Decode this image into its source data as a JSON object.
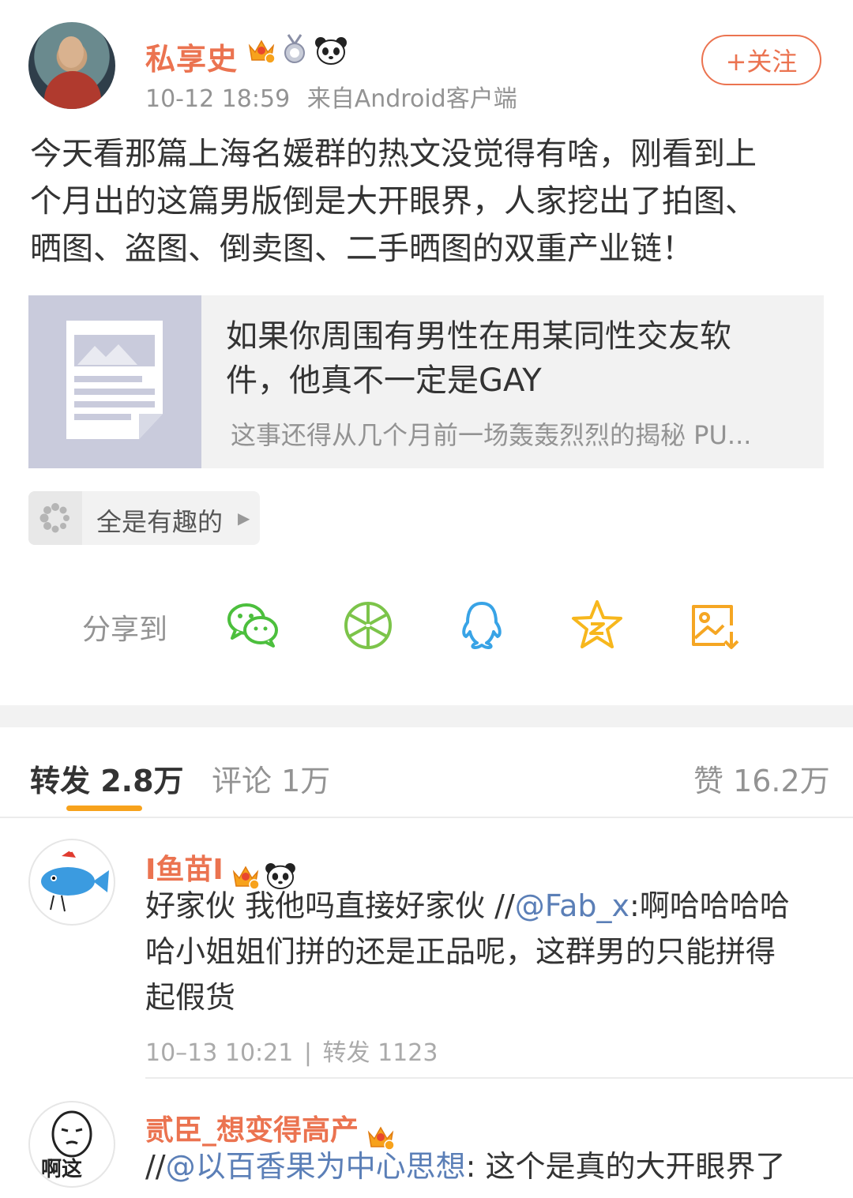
{
  "post": {
    "author": "私享史",
    "time": "10-12 18:59",
    "source": "来自Android客户端",
    "follow_label": "+关注",
    "text_line1": "今天看那篇上海名媛群的热文没觉得有啥，刚看到上",
    "text_line2": "个月出的这篇男版倒是大开眼界，人家挖出了拍图、",
    "text_line3": "晒图、盗图、倒卖图、二手晒图的双重产业链！",
    "link_card": {
      "title_line1": "如果你周围有男性在用某同性交友软",
      "title_line2": "件，他真不一定是GAY",
      "description": "这事还得从几个月前一场轰轰烈烈的揭秘 PU..."
    },
    "topic_chip": "全是有趣的",
    "share_label": "分享到",
    "share_icons": [
      "wechat-icon",
      "moments-icon",
      "qq-icon",
      "qzone-icon",
      "save-image-icon"
    ]
  },
  "tabs": {
    "reposts": "转发 2.8万",
    "comments": "评论 1万",
    "likes": "赞 16.2万"
  },
  "comments": [
    {
      "name": "I鱼苗I",
      "text_pre": "好家伙 我他吗直接好家伙 //",
      "mention": "@Fab_x",
      "text_post_line1": ":啊哈哈哈哈",
      "text_line2": "哈小姐姐们拼的还是正品呢，这群男的只能拼得",
      "text_line3": "起假货",
      "time": "10–13 10:21",
      "separator": "|",
      "reposts": "转发 1123"
    },
    {
      "name": "贰臣_想变得高产",
      "avatar_text": "啊这",
      "text_pre": "//",
      "mention": "@以百香果为中心思想",
      "text_post": ": 这个是真的大开眼界了"
    }
  ],
  "colors": {
    "accent_orange": "#eb7350",
    "tab_underline": "#f7a21c",
    "mention_blue": "#5b7fb7",
    "meta_gray": "#939393",
    "wechat_green": "#4cbf3d",
    "qq_blue": "#38a3e6",
    "qzone_yellow": "#f7b71d"
  }
}
